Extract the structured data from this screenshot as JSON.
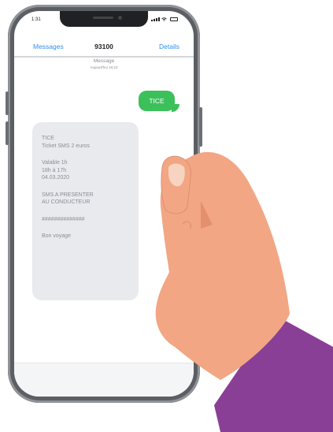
{
  "colors": {
    "accent_blue": "#2e8ff0",
    "sent_bubble": "#3cc05a",
    "received_bubble": "#e9eaee",
    "sleeve": "#8a3f96",
    "skin": "#f2a684",
    "phone_frame": "#5b5f63"
  },
  "status_bar": {
    "time": "1:31",
    "icons": [
      "signal-icon",
      "wifi-icon",
      "battery-icon"
    ]
  },
  "nav": {
    "back_label": "Messages",
    "title": "93100",
    "edit_label": "Details"
  },
  "conversation": {
    "meta_line1": "Message",
    "meta_line2": "Aujourd'hui 16:23"
  },
  "messages": {
    "sent": {
      "text": "TICE"
    },
    "received": {
      "paragraphs": [
        [
          "TICE",
          "Ticket SMS 2 euros"
        ],
        [
          "Valable 1h",
          "18h à 17h",
          "04.03.2020"
        ],
        [
          "SMS A PRESENTER",
          "AU CONDUCTEUR"
        ],
        [
          "##############"
        ],
        [
          "Bon voyage"
        ]
      ]
    }
  }
}
